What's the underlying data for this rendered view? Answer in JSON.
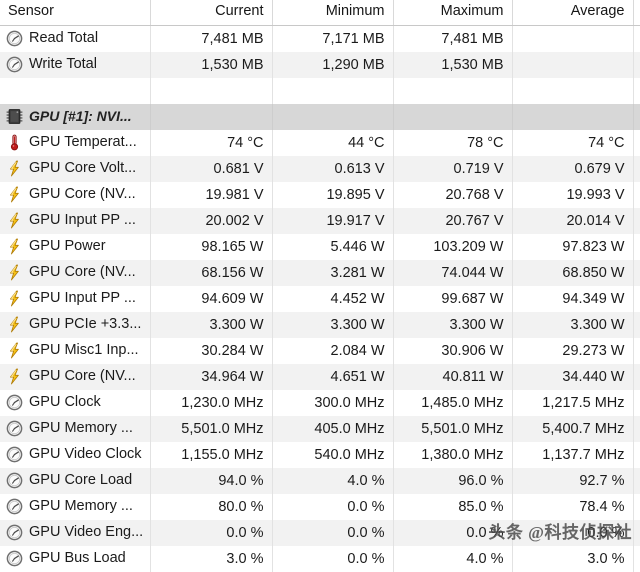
{
  "header": {
    "columns": [
      "Sensor",
      "Current",
      "Minimum",
      "Maximum",
      "Average"
    ]
  },
  "rows": [
    {
      "icon": "clock-icon",
      "name": "Read Total",
      "current": "7,481 MB",
      "minimum": "7,171 MB",
      "maximum": "7,481 MB",
      "average": ""
    },
    {
      "icon": "clock-icon",
      "name": "Write Total",
      "current": "1,530 MB",
      "minimum": "1,290 MB",
      "maximum": "1,530 MB",
      "average": ""
    },
    {
      "icon": "none",
      "name": "",
      "current": "",
      "minimum": "",
      "maximum": "",
      "average": "",
      "kind": "blank"
    },
    {
      "icon": "chip-icon",
      "name": "GPU [#1]: NVI...",
      "current": "",
      "minimum": "",
      "maximum": "",
      "average": "",
      "kind": "group"
    },
    {
      "icon": "thermometer-icon",
      "name": "GPU Temperat...",
      "current": "74 °C",
      "minimum": "44 °C",
      "maximum": "78 °C",
      "average": "74 °C"
    },
    {
      "icon": "lightning-icon",
      "name": "GPU Core Volt...",
      "current": "0.681 V",
      "minimum": "0.613 V",
      "maximum": "0.719 V",
      "average": "0.679 V"
    },
    {
      "icon": "lightning-icon",
      "name": "GPU Core (NV...",
      "current": "19.981 V",
      "minimum": "19.895 V",
      "maximum": "20.768 V",
      "average": "19.993 V"
    },
    {
      "icon": "lightning-icon",
      "name": "GPU Input PP ...",
      "current": "20.002 V",
      "minimum": "19.917 V",
      "maximum": "20.767 V",
      "average": "20.014 V"
    },
    {
      "icon": "lightning-icon",
      "name": "GPU Power",
      "current": "98.165 W",
      "minimum": "5.446 W",
      "maximum": "103.209 W",
      "average": "97.823 W"
    },
    {
      "icon": "lightning-icon",
      "name": "GPU Core (NV...",
      "current": "68.156 W",
      "minimum": "3.281 W",
      "maximum": "74.044 W",
      "average": "68.850 W"
    },
    {
      "icon": "lightning-icon",
      "name": "GPU Input PP ...",
      "current": "94.609 W",
      "minimum": "4.452 W",
      "maximum": "99.687 W",
      "average": "94.349 W"
    },
    {
      "icon": "lightning-icon",
      "name": "GPU PCIe +3.3...",
      "current": "3.300 W",
      "minimum": "3.300 W",
      "maximum": "3.300 W",
      "average": "3.300 W"
    },
    {
      "icon": "lightning-icon",
      "name": "GPU Misc1 Inp...",
      "current": "30.284 W",
      "minimum": "2.084 W",
      "maximum": "30.906 W",
      "average": "29.273 W"
    },
    {
      "icon": "lightning-icon",
      "name": "GPU Core (NV...",
      "current": "34.964 W",
      "minimum": "4.651 W",
      "maximum": "40.811 W",
      "average": "34.440 W"
    },
    {
      "icon": "clock-icon",
      "name": "GPU Clock",
      "current": "1,230.0 MHz",
      "minimum": "300.0 MHz",
      "maximum": "1,485.0 MHz",
      "average": "1,217.5 MHz"
    },
    {
      "icon": "clock-icon",
      "name": "GPU Memory ...",
      "current": "5,501.0 MHz",
      "minimum": "405.0 MHz",
      "maximum": "5,501.0 MHz",
      "average": "5,400.7 MHz"
    },
    {
      "icon": "clock-icon",
      "name": "GPU Video Clock",
      "current": "1,155.0 MHz",
      "minimum": "540.0 MHz",
      "maximum": "1,380.0 MHz",
      "average": "1,137.7 MHz"
    },
    {
      "icon": "clock-icon",
      "name": "GPU Core Load",
      "current": "94.0 %",
      "minimum": "4.0 %",
      "maximum": "96.0 %",
      "average": "92.7 %"
    },
    {
      "icon": "clock-icon",
      "name": "GPU Memory ...",
      "current": "80.0 %",
      "minimum": "0.0 %",
      "maximum": "85.0 %",
      "average": "78.4 %"
    },
    {
      "icon": "clock-icon",
      "name": "GPU Video Eng...",
      "current": "0.0 %",
      "minimum": "0.0 %",
      "maximum": "0.0 %",
      "average": "0.0 %"
    },
    {
      "icon": "clock-icon",
      "name": "GPU Bus Load",
      "current": "3.0 %",
      "minimum": "0.0 %",
      "maximum": "4.0 %",
      "average": "3.0 %"
    }
  ],
  "watermark": {
    "text": "头条 @科技侦探社"
  },
  "colors": {
    "group_row": "#d7d7d7",
    "stripe": "#f2f2f2",
    "lightning": "#f5c016",
    "thermometer": "#c01a1a",
    "chip": "#3a3a3a"
  }
}
